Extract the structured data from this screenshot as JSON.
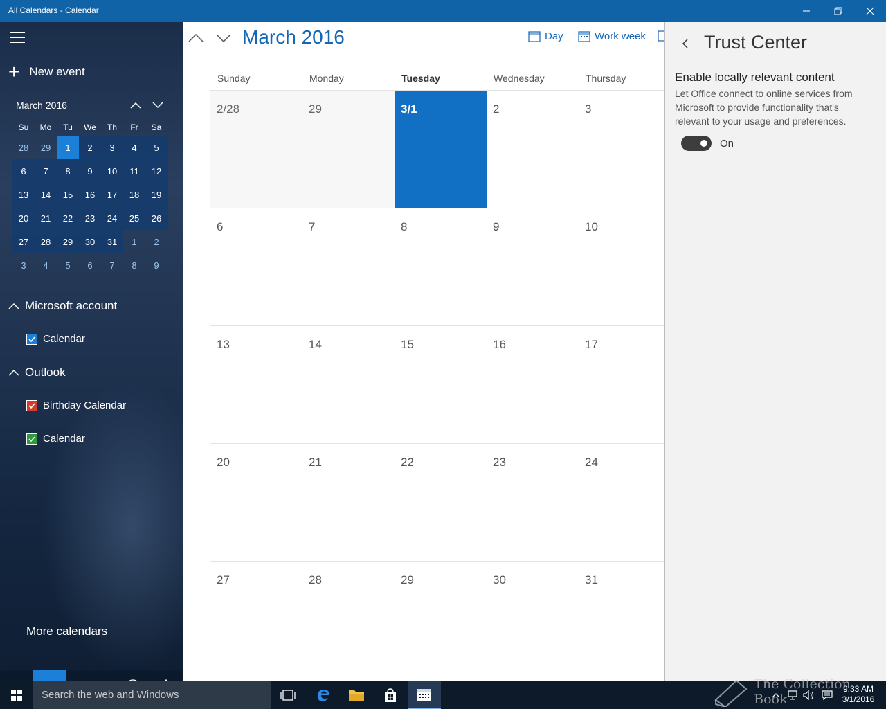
{
  "window": {
    "title": "All Calendars - Calendar"
  },
  "sidebar": {
    "new_event": "New event",
    "mini_cal": {
      "title": "March 2016",
      "weekdays": [
        "Su",
        "Mo",
        "Tu",
        "We",
        "Th",
        "Fr",
        "Sa"
      ],
      "weeks": [
        [
          "28",
          "29",
          "1",
          "2",
          "3",
          "4",
          "5"
        ],
        [
          "6",
          "7",
          "8",
          "9",
          "10",
          "11",
          "12"
        ],
        [
          "13",
          "14",
          "15",
          "16",
          "17",
          "18",
          "19"
        ],
        [
          "20",
          "21",
          "22",
          "23",
          "24",
          "25",
          "26"
        ],
        [
          "27",
          "28",
          "29",
          "30",
          "31",
          "1",
          "2"
        ],
        [
          "3",
          "4",
          "5",
          "6",
          "7",
          "8",
          "9"
        ]
      ]
    },
    "groups": [
      {
        "name": "Microsoft account",
        "calendars": [
          {
            "label": "Calendar",
            "color": "#1c7fd8"
          }
        ]
      },
      {
        "name": "Outlook",
        "calendars": [
          {
            "label": "Birthday Calendar",
            "color": "#d13c2b"
          },
          {
            "label": "Calendar",
            "color": "#2e9a3d"
          }
        ]
      }
    ],
    "more_calendars": "More calendars"
  },
  "main": {
    "month_title": "March 2016",
    "views": {
      "day": "Day",
      "work_week": "Work week"
    },
    "weekdays": [
      "Sunday",
      "Monday",
      "Tuesday",
      "Wednesday",
      "Thursday"
    ],
    "weeks": [
      [
        "2/28",
        "29",
        "3/1",
        "2",
        "3"
      ],
      [
        "6",
        "7",
        "8",
        "9",
        "10"
      ],
      [
        "13",
        "14",
        "15",
        "16",
        "17"
      ],
      [
        "20",
        "21",
        "22",
        "23",
        "24"
      ],
      [
        "27",
        "28",
        "29",
        "30",
        "31"
      ]
    ]
  },
  "panel": {
    "title": "Trust Center",
    "heading": "Enable locally relevant content",
    "description": "Let Office connect to online services from Microsoft to provide functionality that's relevant to your usage and preferences.",
    "toggle_label": "On"
  },
  "taskbar": {
    "search_placeholder": "Search the web and Windows",
    "time": "9:33 AM",
    "date": "3/1/2016"
  },
  "watermark": "The Collection Book",
  "colors": {
    "accent": "#1467b6",
    "today": "#1270c4",
    "titlebar": "#1163a8"
  }
}
